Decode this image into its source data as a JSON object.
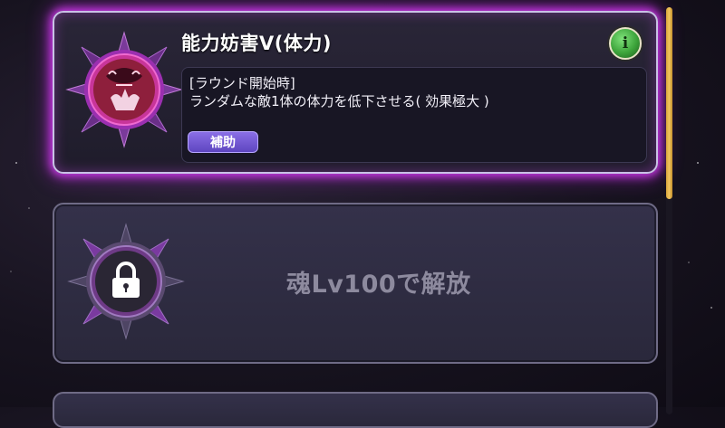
{
  "skills": [
    {
      "status": "active",
      "title": "能力妨害Ⅴ(体力)",
      "description_lines": [
        "[ラウンド開始時]",
        "ランダムな敵1体の体力を低下させる( 効果極大 )"
      ],
      "tag": "補助",
      "info_button": "i",
      "emblem_icon": "cursed-figure-icon"
    },
    {
      "status": "locked",
      "unlock_text": "魂Lv100で解放",
      "emblem_icon": "padlock-icon"
    }
  ],
  "scroll": {
    "position": 0.0
  },
  "colors": {
    "glow": "#e23cff",
    "tag": "#6e54d6",
    "info": "#3ca33a",
    "scroll_thumb": "#e8b64a"
  }
}
